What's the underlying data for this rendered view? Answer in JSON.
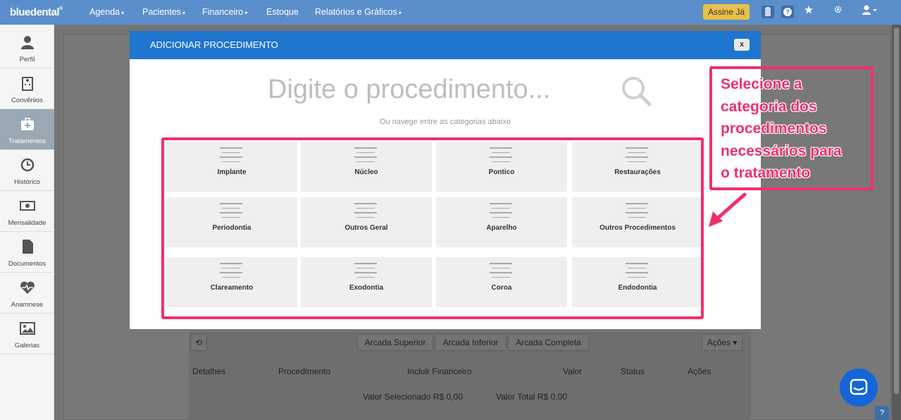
{
  "topbar": {
    "brand": "bluedental",
    "brand_mark": "®",
    "nav": [
      {
        "label": "Agenda",
        "caret": true
      },
      {
        "label": "Pacientes",
        "caret": true
      },
      {
        "label": "Financeiro",
        "caret": true
      },
      {
        "label": "Estoque",
        "caret": false
      },
      {
        "label": "Relatórios e Gráficos",
        "caret": true
      }
    ],
    "assine_label": "Assine Já",
    "help_label": "?",
    "caret": "▾"
  },
  "sidebar": {
    "items": [
      {
        "label": "Perfil",
        "icon": "user-icon",
        "glyph": "👤"
      },
      {
        "label": "Convênios",
        "icon": "hospital-icon",
        "glyph": "🏥"
      },
      {
        "label": "Tratamentos",
        "icon": "medkit-icon",
        "glyph": "✚"
      },
      {
        "label": "Histórico",
        "icon": "history-icon",
        "glyph": "⟲"
      },
      {
        "label": "Mensalidade",
        "icon": "money-icon",
        "glyph": "$"
      },
      {
        "label": "Documentos",
        "icon": "document-icon",
        "glyph": "▤"
      },
      {
        "label": "Anamnese",
        "icon": "heartbeat-icon",
        "glyph": "♥"
      },
      {
        "label": "Galerias",
        "icon": "picture-icon",
        "glyph": "▣"
      }
    ]
  },
  "background": {
    "buttons": [
      "Arcada Superior",
      "Arcada Inferior",
      "Arcada Completa"
    ],
    "acoes_dropdown": "Ações",
    "columns": [
      "Detalhes",
      "Procedimento",
      "Incluir Financeiro",
      "Valor",
      "Status",
      "Ações"
    ],
    "valor_selecionado": "Valor Selecionado R$ 0,00",
    "valor_total": "Valor Total R$ 0,00"
  },
  "modal": {
    "title": "ADICIONAR PROCEDIMENTO",
    "close_label": "x",
    "search_placeholder": "Digite o procedimento...",
    "hint": "Ou navege entre as categorias abaixo",
    "categories": [
      "Implante",
      "Núcleo",
      "Pontico",
      "Restaurações",
      "Periodontia",
      "Outros Geral",
      "Aparelho",
      "Outros Procedimentos",
      "Clareamento",
      "Exodontia",
      "Coroa",
      "Endodontia"
    ]
  },
  "annotation": {
    "lines": [
      "Selecione a",
      "categoria dos",
      "procedimentos",
      "necessários para",
      "o tratamento"
    ],
    "color": "#f0306a"
  },
  "colors": {
    "topbar": "#5b8fcc",
    "modal_header": "#1e76cf",
    "assine": "#e8c14a"
  }
}
